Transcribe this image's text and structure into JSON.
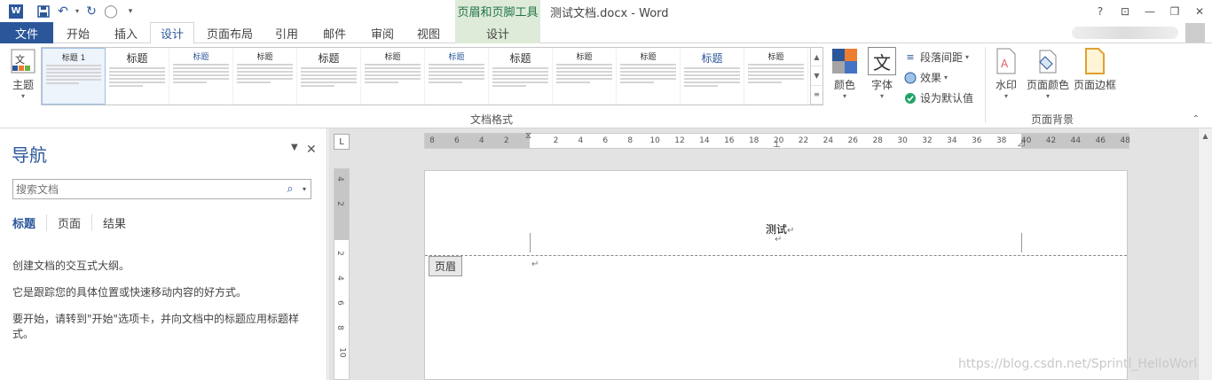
{
  "title_bar": {
    "app_icon": "W",
    "context_group": "页眉和页脚工具",
    "document_title": "测试文档.docx - Word",
    "help": "?",
    "minimize": "—",
    "restore": "❐",
    "close": "✕"
  },
  "tabs": {
    "file": "文件",
    "home": "开始",
    "insert": "插入",
    "design": "设计",
    "layout": "页面布局",
    "references": "引用",
    "mailings": "邮件",
    "review": "审阅",
    "view": "视图",
    "hf_design": "设计"
  },
  "ribbon": {
    "theme": "主题",
    "gallery": [
      {
        "title": "标题 1",
        "style": "默认"
      },
      {
        "title": "标题",
        "style": "a"
      },
      {
        "title": "标题",
        "style": "b"
      },
      {
        "title": "标题",
        "style": "c"
      },
      {
        "title": "标题",
        "style": "d"
      },
      {
        "title": "标题",
        "style": "e"
      },
      {
        "title": "标题",
        "style": "f"
      },
      {
        "title": "标题",
        "style": "g"
      },
      {
        "title": "标题",
        "style": "h"
      },
      {
        "title": "标题",
        "style": "i"
      },
      {
        "title": "标题",
        "style": "j"
      },
      {
        "title": "标题",
        "style": "k"
      }
    ],
    "colors": "颜色",
    "fonts": "字体",
    "fonts_icon_glyph": "文",
    "paragraph_spacing": "段落间距",
    "effects": "效果",
    "set_default": "设为默认值",
    "group_doc_format": "文档格式",
    "watermark": "水印",
    "page_color": "页面颜色",
    "page_borders": "页面边框",
    "group_page_bg": "页面背景"
  },
  "nav": {
    "title": "导航",
    "search_placeholder": "搜索文档",
    "tab_headings": "标题",
    "tab_pages": "页面",
    "tab_results": "结果",
    "msg1": "创建文档的交互式大纲。",
    "msg2": "它是跟踪您的具体位置或快速移动内容的好方式。",
    "msg3": "要开始，请转到\"开始\"选项卡，并向文档中的标题应用标题样式。"
  },
  "ruler": {
    "corner": "L",
    "ticks": [
      "8",
      "6",
      "4",
      "2",
      "",
      "2",
      "4",
      "6",
      "8",
      "10",
      "12",
      "14",
      "16",
      "18",
      "20",
      "22",
      "24",
      "26",
      "28",
      "30",
      "32",
      "34",
      "36",
      "38",
      "40",
      "42",
      "44",
      "46",
      "48"
    ],
    "vticks": [
      "4",
      "2",
      "",
      "2",
      "4",
      "6",
      "8",
      "10"
    ]
  },
  "document": {
    "header_text": "测试",
    "para_mark": "↵",
    "header_tag": "页眉"
  },
  "watermark": "https://blog.csdn.net/Sprintl_HelloWorld",
  "colors": {
    "accent": "#2b579a",
    "context_green": "#217346",
    "context_bg": "#ddebd8"
  }
}
